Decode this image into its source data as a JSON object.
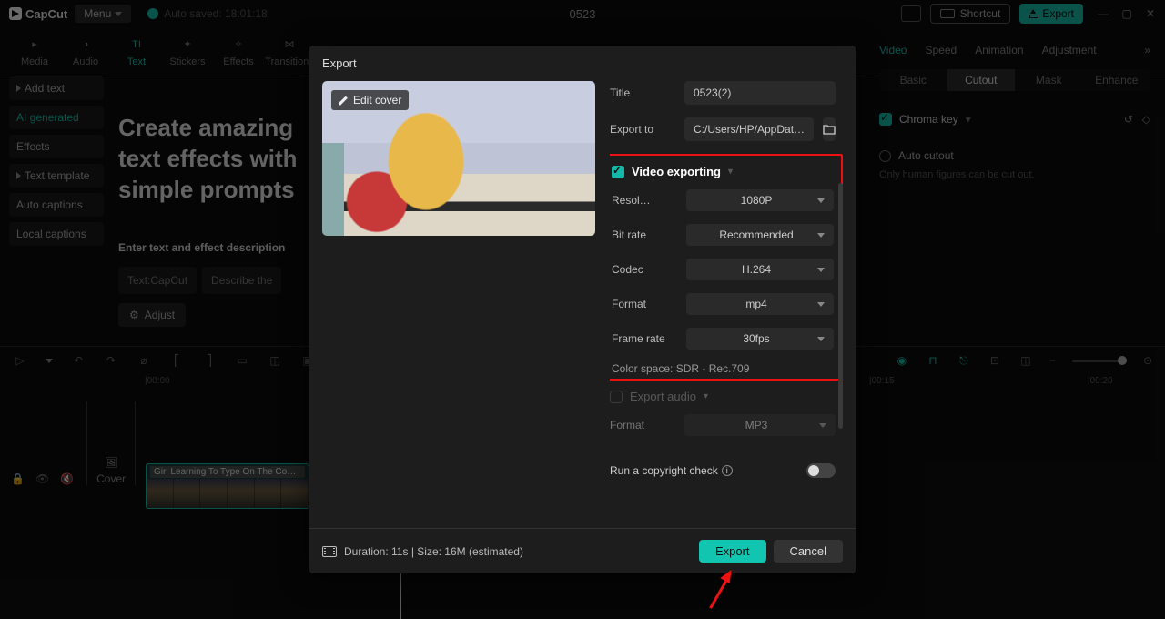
{
  "topbar": {
    "logo": "CapCut",
    "menu": "Menu",
    "autosave": "Auto saved: 18:01:18",
    "project_title": "0523",
    "shortcut": "Shortcut",
    "export": "Export"
  },
  "tabs": {
    "media": "Media",
    "audio": "Audio",
    "text": "Text",
    "stickers": "Stickers",
    "effects": "Effects",
    "transitions": "Transitions"
  },
  "sidebar": {
    "add_text": "Add text",
    "ai_generated": "AI generated",
    "effects": "Effects",
    "text_template": "Text template",
    "auto_captions": "Auto captions",
    "local_captions": "Local captions"
  },
  "center": {
    "hero": "Create amazing text effects with simple prompts",
    "prompt_label": "Enter text and effect description",
    "prompt1": "Text:CapCut",
    "prompt2": "Describe the",
    "adjust": "Adjust"
  },
  "right": {
    "tabs": {
      "video": "Video",
      "speed": "Speed",
      "animation": "Animation",
      "adjustment": "Adjustment"
    },
    "subtabs": {
      "basic": "Basic",
      "cutout": "Cutout",
      "mask": "Mask",
      "enhance": "Enhance"
    },
    "chroma": "Chroma key",
    "auto_cutout": "Auto cutout",
    "hint": "Only human figures can be cut out."
  },
  "timeline": {
    "t0": "|00:00",
    "t1": "|00:15",
    "t2": "|00:20",
    "cover": "Cover",
    "clip_name": "Girl Learning To Type On The Computer"
  },
  "modal": {
    "title": "Export",
    "edit_cover": "Edit cover",
    "labels": {
      "title": "Title",
      "export_to": "Export to",
      "video_exporting": "Video exporting",
      "resolution": "Resol…",
      "bitrate": "Bit rate",
      "codec": "Codec",
      "format": "Format",
      "framerate": "Frame rate",
      "export_audio": "Export audio",
      "audio_format": "Format"
    },
    "values": {
      "title": "0523(2)",
      "export_to": "C:/Users/HP/AppDat…",
      "resolution": "1080P",
      "bitrate": "Recommended",
      "codec": "H.264",
      "format": "mp4",
      "framerate": "30fps",
      "color_space": "Color space: SDR - Rec.709",
      "audio_format": "MP3"
    },
    "copyright": "Run a copyright check",
    "footer_info": "Duration: 11s | Size: 16M (estimated)",
    "export_btn": "Export",
    "cancel_btn": "Cancel"
  }
}
